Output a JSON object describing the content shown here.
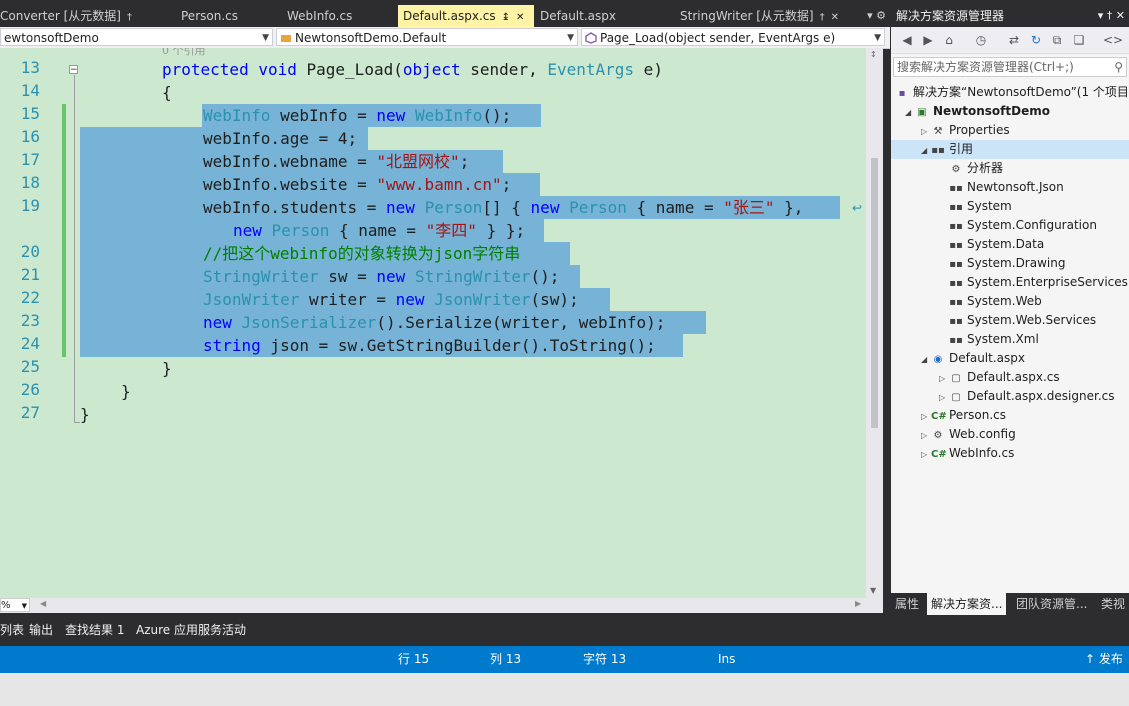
{
  "tabs": [
    {
      "label": "Converter [从元数据]",
      "pin": "†"
    },
    {
      "label": "Person.cs"
    },
    {
      "label": "WebInfo.cs"
    },
    {
      "label": "Default.aspx.cs",
      "pin": "↨",
      "close": "✕"
    },
    {
      "label": "Default.aspx"
    },
    {
      "label": "StringWriter [从元数据]",
      "pin": "†",
      "close": "✕"
    }
  ],
  "tab_controls": "▾ ⚙",
  "navbar": {
    "project": "ewtonsoftDemo",
    "class": "NewtonsoftDemo.Default",
    "member": "Page_Load(object sender, EventArgs e)"
  },
  "editor": {
    "ref_count": "0 个引用",
    "line_numbers": [
      "13",
      "14",
      "15",
      "16",
      "17",
      "18",
      "19",
      "20",
      "21",
      "22",
      "23",
      "24",
      "25",
      "26",
      "27"
    ],
    "lines": {
      "l13": {
        "kw1": "protected",
        "kw2": "void",
        "name": "Page_Load(",
        "kw3": "object",
        "p1": " sender, ",
        "ty": "EventArgs",
        "p2": " e)"
      },
      "l14": "{",
      "l15": {
        "ty1": "WebInfo",
        "p1": " webInfo = ",
        "kw": "new",
        "ty2": "WebInfo",
        "p2": "();"
      },
      "l16": "webInfo.age = 4;",
      "l17": {
        "p1": "webInfo.webname = ",
        "s": "\"北盟网校\"",
        "p2": ";"
      },
      "l18": {
        "p1": "webInfo.website = ",
        "s": "\"www.bamn.cn\"",
        "p2": ";"
      },
      "l19": {
        "p1": "webInfo.students = ",
        "kw1": "new",
        "ty1": "Person",
        "p2": "[] { ",
        "kw2": "new",
        "ty2": "Person",
        "p3": " { name = ",
        "s": "\"张三\"",
        "p4": " },"
      },
      "l19b": {
        "kw": "new",
        "ty": "Person",
        "p1": " { name = ",
        "s": "\"李四\"",
        "p2": " } };"
      },
      "l20": "//把这个webinfo的对象转换为json字符串",
      "l21": {
        "ty1": "StringWriter",
        "p1": " sw = ",
        "kw": "new",
        "ty2": "StringWriter",
        "p2": "();"
      },
      "l22": {
        "ty1": "JsonWriter",
        "p1": " writer = ",
        "kw": "new",
        "ty2": "JsonWriter",
        "p2": "(sw);"
      },
      "l23": {
        "kw": "new",
        "ty": "JsonSerializer",
        "p1": "().Serialize(writer, webInfo);"
      },
      "l24": {
        "kw": "string",
        "p1": " json = sw.GetStringBuilder().ToString();"
      },
      "l25": "}",
      "l26": "}",
      "l27": "}"
    },
    "zoom": "%"
  },
  "solution_explorer": {
    "title": "解决方案资源管理器",
    "title_controls": "▾ † ✕",
    "search_placeholder": "搜索解决方案资源管理器(Ctrl+;)",
    "tree": [
      {
        "label": "解决方案“NewtonsoftDemo”(1 个项目",
        "icon": "solution-icon"
      },
      {
        "label": "NewtonsoftDemo",
        "icon": "project-icon",
        "bold": true
      },
      {
        "label": "Properties",
        "icon": "wrench-icon"
      },
      {
        "label": "引用",
        "icon": "references-icon",
        "selected": true
      },
      {
        "label": "分析器",
        "icon": "analyzer-icon"
      },
      {
        "label": "Newtonsoft.Json",
        "icon": "reference-icon"
      },
      {
        "label": "System",
        "icon": "reference-icon"
      },
      {
        "label": "System.Configuration",
        "icon": "reference-icon"
      },
      {
        "label": "System.Data",
        "icon": "reference-icon"
      },
      {
        "label": "System.Drawing",
        "icon": "reference-icon"
      },
      {
        "label": "System.EnterpriseServices",
        "icon": "reference-icon"
      },
      {
        "label": "System.Web",
        "icon": "reference-icon"
      },
      {
        "label": "System.Web.Services",
        "icon": "reference-icon"
      },
      {
        "label": "System.Xml",
        "icon": "reference-icon"
      },
      {
        "label": "Default.aspx",
        "icon": "web-file-icon"
      },
      {
        "label": "Default.aspx.cs",
        "icon": "cs-file-icon"
      },
      {
        "label": "Default.aspx.designer.cs",
        "icon": "cs-file-icon"
      },
      {
        "label": "Person.cs",
        "icon": "csharp-icon"
      },
      {
        "label": "Web.config",
        "icon": "config-icon"
      },
      {
        "label": "WebInfo.cs",
        "icon": "csharp-icon"
      }
    ],
    "bottom_tabs": [
      "属性",
      "解决方案资...",
      "团队资源管...",
      "类视"
    ]
  },
  "output_tabs": [
    "列表",
    "输出",
    "查找结果 1",
    "Azure 应用服务活动"
  ],
  "status": {
    "line": "行 15",
    "col": "列 13",
    "ch": "字符 13",
    "mode": "Ins",
    "publish": "↑ 发布"
  },
  "colors": {
    "accent": "#007acc",
    "editor_bg": "#cce8cf",
    "selection": "#76b3d6"
  }
}
